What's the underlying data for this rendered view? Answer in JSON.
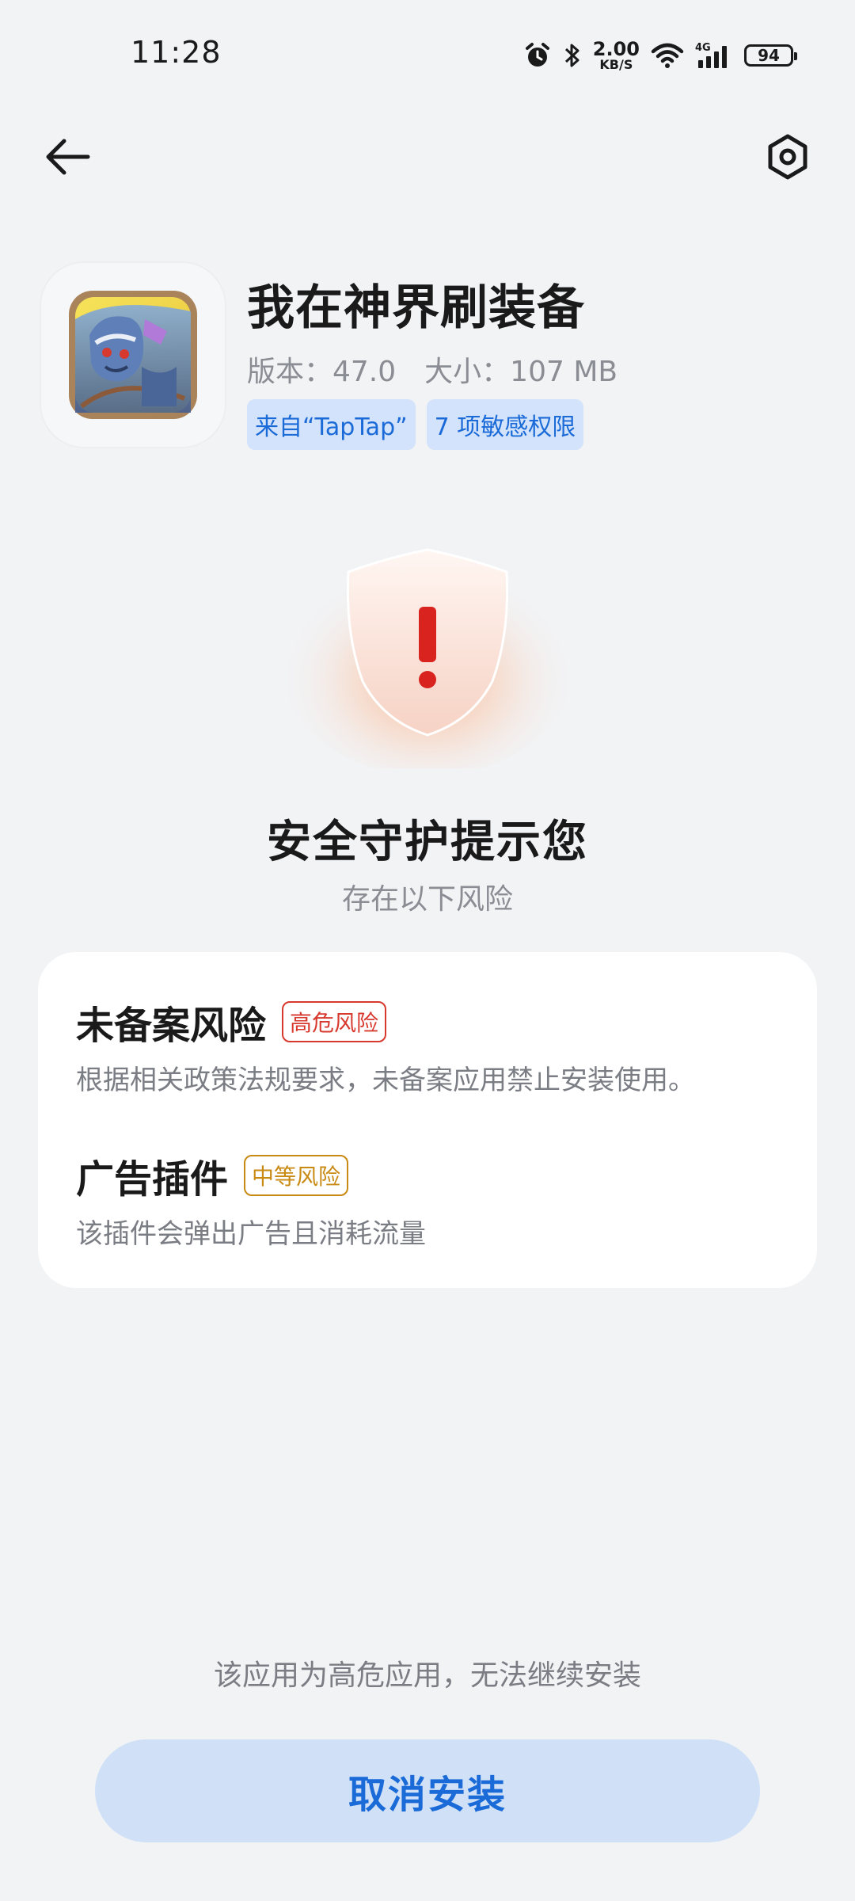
{
  "status_bar": {
    "time": "11:28",
    "network_speed_value": "2.00",
    "network_speed_unit": "KB/S",
    "network_type": "4G",
    "battery_level": "94"
  },
  "app": {
    "name": "我在神界刷装备",
    "version": "版本：47.0",
    "size": "大小：107 MB",
    "tags": [
      "来自“TapTap”",
      "7 项敏感权限"
    ]
  },
  "warning": {
    "title": "安全守护提示您",
    "subtitle": "存在以下风险"
  },
  "risks": [
    {
      "title": "未备案风险",
      "badge": "高危风险",
      "description": "根据相关政策法规要求，未备案应用禁止安装使用。"
    },
    {
      "title": "广告插件",
      "badge": "中等风险",
      "description": "该插件会弹出广告且消耗流量"
    }
  ],
  "footer": {
    "note": "该应用为高危应用，无法继续安装",
    "cancel_label": "取消安装"
  },
  "colors": {
    "accent": "#1a6ad8",
    "high_risk": "#d8392f",
    "medium_risk": "#c98a14",
    "background": "#f2f3f5"
  }
}
